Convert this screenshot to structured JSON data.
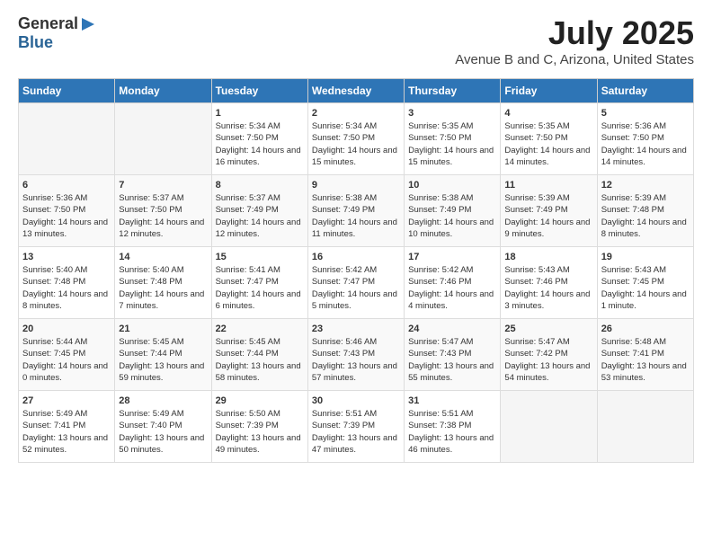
{
  "header": {
    "logo_general": "General",
    "logo_blue": "Blue",
    "title": "July 2025",
    "subtitle": "Avenue B and C, Arizona, United States"
  },
  "days_of_week": [
    "Sunday",
    "Monday",
    "Tuesday",
    "Wednesday",
    "Thursday",
    "Friday",
    "Saturday"
  ],
  "weeks": [
    [
      {
        "day": "",
        "content": ""
      },
      {
        "day": "",
        "content": ""
      },
      {
        "day": "1",
        "content": "Sunrise: 5:34 AM\nSunset: 7:50 PM\nDaylight: 14 hours and 16 minutes."
      },
      {
        "day": "2",
        "content": "Sunrise: 5:34 AM\nSunset: 7:50 PM\nDaylight: 14 hours and 15 minutes."
      },
      {
        "day": "3",
        "content": "Sunrise: 5:35 AM\nSunset: 7:50 PM\nDaylight: 14 hours and 15 minutes."
      },
      {
        "day": "4",
        "content": "Sunrise: 5:35 AM\nSunset: 7:50 PM\nDaylight: 14 hours and 14 minutes."
      },
      {
        "day": "5",
        "content": "Sunrise: 5:36 AM\nSunset: 7:50 PM\nDaylight: 14 hours and 14 minutes."
      }
    ],
    [
      {
        "day": "6",
        "content": "Sunrise: 5:36 AM\nSunset: 7:50 PM\nDaylight: 14 hours and 13 minutes."
      },
      {
        "day": "7",
        "content": "Sunrise: 5:37 AM\nSunset: 7:50 PM\nDaylight: 14 hours and 12 minutes."
      },
      {
        "day": "8",
        "content": "Sunrise: 5:37 AM\nSunset: 7:49 PM\nDaylight: 14 hours and 12 minutes."
      },
      {
        "day": "9",
        "content": "Sunrise: 5:38 AM\nSunset: 7:49 PM\nDaylight: 14 hours and 11 minutes."
      },
      {
        "day": "10",
        "content": "Sunrise: 5:38 AM\nSunset: 7:49 PM\nDaylight: 14 hours and 10 minutes."
      },
      {
        "day": "11",
        "content": "Sunrise: 5:39 AM\nSunset: 7:49 PM\nDaylight: 14 hours and 9 minutes."
      },
      {
        "day": "12",
        "content": "Sunrise: 5:39 AM\nSunset: 7:48 PM\nDaylight: 14 hours and 8 minutes."
      }
    ],
    [
      {
        "day": "13",
        "content": "Sunrise: 5:40 AM\nSunset: 7:48 PM\nDaylight: 14 hours and 8 minutes."
      },
      {
        "day": "14",
        "content": "Sunrise: 5:40 AM\nSunset: 7:48 PM\nDaylight: 14 hours and 7 minutes."
      },
      {
        "day": "15",
        "content": "Sunrise: 5:41 AM\nSunset: 7:47 PM\nDaylight: 14 hours and 6 minutes."
      },
      {
        "day": "16",
        "content": "Sunrise: 5:42 AM\nSunset: 7:47 PM\nDaylight: 14 hours and 5 minutes."
      },
      {
        "day": "17",
        "content": "Sunrise: 5:42 AM\nSunset: 7:46 PM\nDaylight: 14 hours and 4 minutes."
      },
      {
        "day": "18",
        "content": "Sunrise: 5:43 AM\nSunset: 7:46 PM\nDaylight: 14 hours and 3 minutes."
      },
      {
        "day": "19",
        "content": "Sunrise: 5:43 AM\nSunset: 7:45 PM\nDaylight: 14 hours and 1 minute."
      }
    ],
    [
      {
        "day": "20",
        "content": "Sunrise: 5:44 AM\nSunset: 7:45 PM\nDaylight: 14 hours and 0 minutes."
      },
      {
        "day": "21",
        "content": "Sunrise: 5:45 AM\nSunset: 7:44 PM\nDaylight: 13 hours and 59 minutes."
      },
      {
        "day": "22",
        "content": "Sunrise: 5:45 AM\nSunset: 7:44 PM\nDaylight: 13 hours and 58 minutes."
      },
      {
        "day": "23",
        "content": "Sunrise: 5:46 AM\nSunset: 7:43 PM\nDaylight: 13 hours and 57 minutes."
      },
      {
        "day": "24",
        "content": "Sunrise: 5:47 AM\nSunset: 7:43 PM\nDaylight: 13 hours and 55 minutes."
      },
      {
        "day": "25",
        "content": "Sunrise: 5:47 AM\nSunset: 7:42 PM\nDaylight: 13 hours and 54 minutes."
      },
      {
        "day": "26",
        "content": "Sunrise: 5:48 AM\nSunset: 7:41 PM\nDaylight: 13 hours and 53 minutes."
      }
    ],
    [
      {
        "day": "27",
        "content": "Sunrise: 5:49 AM\nSunset: 7:41 PM\nDaylight: 13 hours and 52 minutes."
      },
      {
        "day": "28",
        "content": "Sunrise: 5:49 AM\nSunset: 7:40 PM\nDaylight: 13 hours and 50 minutes."
      },
      {
        "day": "29",
        "content": "Sunrise: 5:50 AM\nSunset: 7:39 PM\nDaylight: 13 hours and 49 minutes."
      },
      {
        "day": "30",
        "content": "Sunrise: 5:51 AM\nSunset: 7:39 PM\nDaylight: 13 hours and 47 minutes."
      },
      {
        "day": "31",
        "content": "Sunrise: 5:51 AM\nSunset: 7:38 PM\nDaylight: 13 hours and 46 minutes."
      },
      {
        "day": "",
        "content": ""
      },
      {
        "day": "",
        "content": ""
      }
    ]
  ]
}
